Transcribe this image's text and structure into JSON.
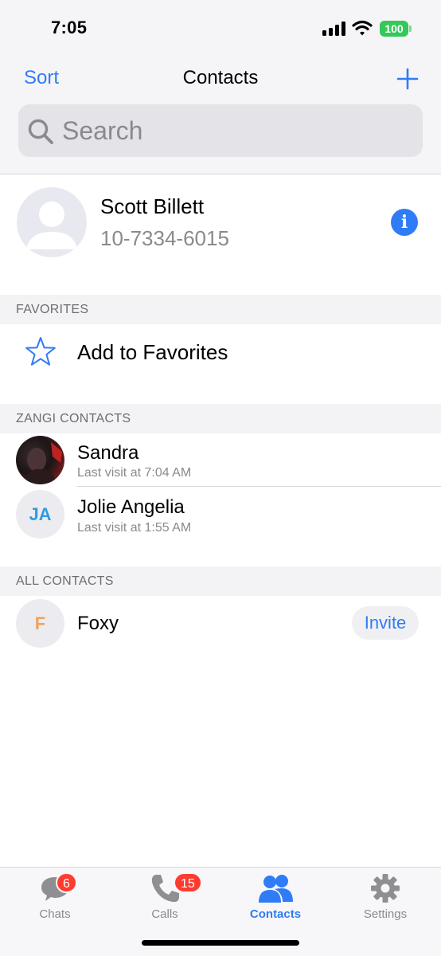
{
  "status_bar": {
    "time": "7:05",
    "battery": "100"
  },
  "nav": {
    "sort_label": "Sort",
    "title": "Contacts"
  },
  "search": {
    "placeholder": "Search"
  },
  "me": {
    "name": "Scott Billett",
    "phone": "10-7334-6015"
  },
  "favorites": {
    "header": "FAVORITES",
    "add_label": "Add to Favorites"
  },
  "zangi_contacts": {
    "header": "ZANGI CONTACTS",
    "items": [
      {
        "name": "Sandra",
        "last_visit": "Last visit at 7:04 AM"
      },
      {
        "name": "Jolie Angelia",
        "initials": "JA",
        "last_visit": "Last visit at 1:55 AM"
      }
    ]
  },
  "all_contacts": {
    "header": "ALL CONTACTS",
    "items": [
      {
        "name": "Foxy",
        "initials": "F",
        "action": "Invite"
      }
    ]
  },
  "tabs": [
    {
      "label": "Chats",
      "badge": "6"
    },
    {
      "label": "Calls",
      "badge": "15"
    },
    {
      "label": "Contacts",
      "active": true
    },
    {
      "label": "Settings"
    }
  ],
  "colors": {
    "accent": "#2f7cf6",
    "badge": "#ff3b30",
    "ja_initials": "#2f9be0",
    "f_initials": "#f0a060"
  }
}
